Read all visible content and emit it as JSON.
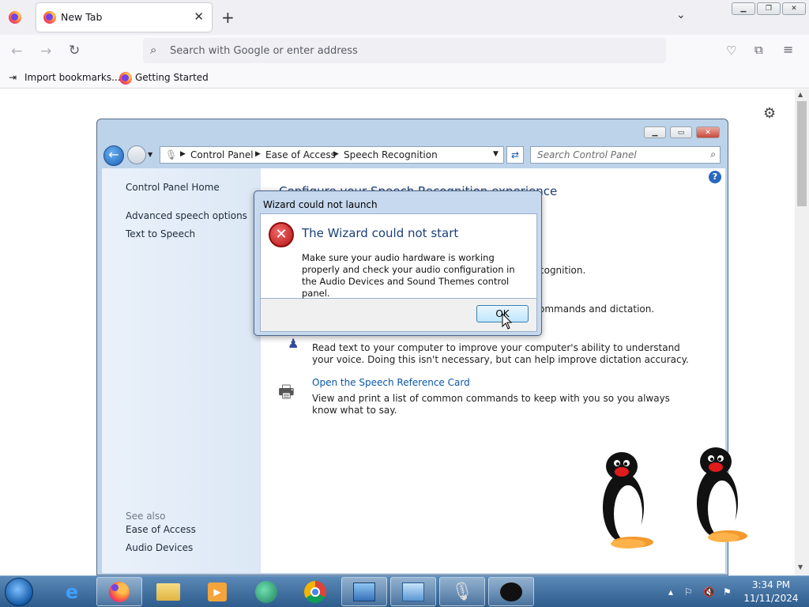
{
  "browser": {
    "tab_title": "New Tab",
    "new_tab": "+",
    "urlbar_placeholder": "Search with Google or enter address",
    "bookmarks": [
      {
        "label": "Import bookmarks..."
      },
      {
        "label": "Getting Started"
      }
    ],
    "window_buttons": [
      "minimize",
      "restore",
      "close"
    ]
  },
  "control_panel": {
    "breadcrumb": [
      "Control Panel",
      "Ease of Access",
      "Speech Recognition"
    ],
    "search_placeholder": "Search Control Panel",
    "help": "?",
    "sidebar": {
      "links": [
        "Control Panel Home",
        "Advanced speech options",
        "Text to Speech"
      ],
      "see_also_title": "See also",
      "see_also": [
        "Ease of Access",
        "Audio Devices"
      ]
    },
    "main": {
      "heading": "Configure your Speech Recognition experience",
      "partial_1": "cognition.",
      "partial_2": "ommands and dictation.",
      "training_desc": "Read text to your computer to improve your computer's ability to understand your voice. Doing this isn't necessary, but can help improve dictation accuracy.",
      "reference_link": "Open the Speech Reference Card",
      "reference_desc": "View and print a list of common commands to keep with you so you always know what to say."
    }
  },
  "dialog": {
    "title": "Wizard could not launch",
    "heading": "The Wizard could not start",
    "message": "Make sure your audio hardware is working properly and check your audio configuration in the Audio Devices and Sound Themes control panel.",
    "ok": "OK"
  },
  "taskbar": {
    "apps": [
      "firefox-icon",
      "internet-explorer-icon",
      "file-explorer-icon",
      "media-player-icon",
      "green-app-icon",
      "chrome-icon",
      "control-panel-icon",
      "network-icon",
      "microphone-icon",
      "pingu-icon"
    ],
    "time": "3:34 PM",
    "date": "11/11/2024"
  }
}
